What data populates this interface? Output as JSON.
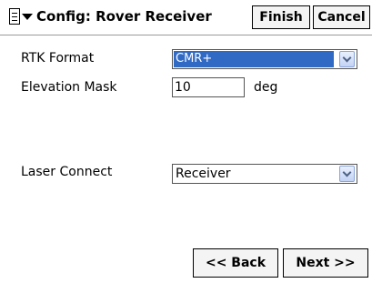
{
  "titlebar": {
    "title": "Config: Rover Receiver",
    "finish_label": "Finish",
    "cancel_label": "Cancel"
  },
  "form": {
    "rtk_format": {
      "label": "RTK Format",
      "value": "CMR+"
    },
    "elevation_mask": {
      "label": "Elevation Mask",
      "value": "10",
      "unit": "deg"
    },
    "laser_connect": {
      "label": "Laser Connect",
      "value": "Receiver"
    }
  },
  "footer": {
    "back_label": "<< Back",
    "next_label": "Next >>"
  },
  "colors": {
    "selection": "#316ac5",
    "dropdown_arrow": "#4d6185"
  },
  "icons": {
    "menu": "document-menu-icon",
    "dropdown": "chevron-down-icon"
  }
}
